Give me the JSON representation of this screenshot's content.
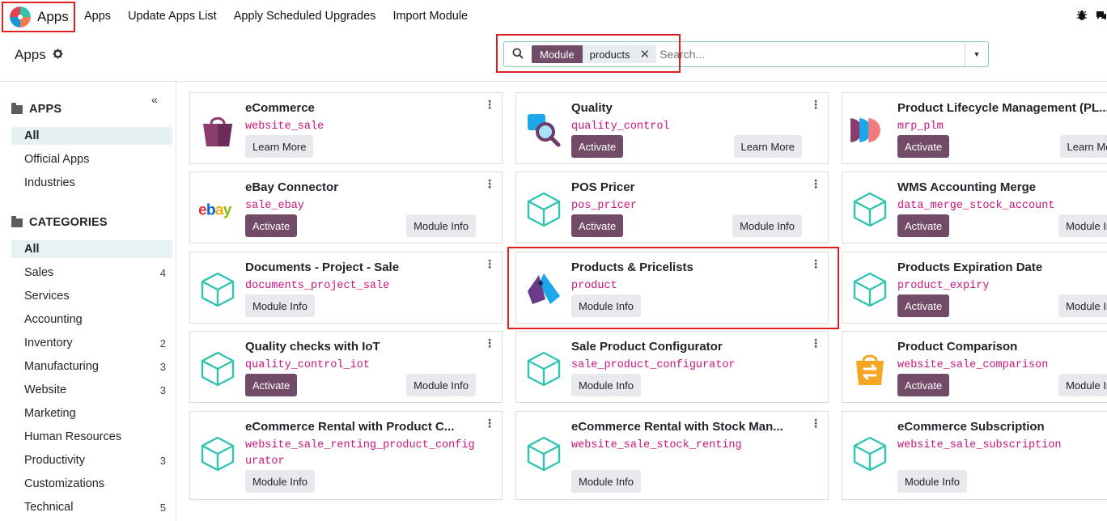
{
  "navbar": {
    "brand": "Apps",
    "menu": [
      "Apps",
      "Update Apps List",
      "Apply Scheduled Upgrades",
      "Import Module"
    ],
    "icons": [
      "bug-icon",
      "chat-icon"
    ]
  },
  "control_panel": {
    "breadcrumb": "Apps",
    "search": {
      "facet_field": "Module",
      "facet_value": "products",
      "placeholder": "Search..."
    }
  },
  "sidebar": {
    "apps_title": "APPS",
    "apps": [
      "All",
      "Official Apps",
      "Industries"
    ],
    "categories_title": "CATEGORIES",
    "categories": [
      {
        "label": "All",
        "count": ""
      },
      {
        "label": "Sales",
        "count": "4"
      },
      {
        "label": "Services",
        "count": ""
      },
      {
        "label": "Accounting",
        "count": ""
      },
      {
        "label": "Inventory",
        "count": "2"
      },
      {
        "label": "Manufacturing",
        "count": "3"
      },
      {
        "label": "Website",
        "count": "3"
      },
      {
        "label": "Marketing",
        "count": ""
      },
      {
        "label": "Human Resources",
        "count": ""
      },
      {
        "label": "Productivity",
        "count": "3"
      },
      {
        "label": "Customizations",
        "count": ""
      },
      {
        "label": "Technical",
        "count": "5"
      }
    ]
  },
  "cards": [
    {
      "title": "eCommerce",
      "tech_name": "website_sale",
      "tech_name_2": "",
      "icon": "shopping-bag-icon",
      "primary": "",
      "secondary": "Learn More"
    },
    {
      "title": "Quality",
      "tech_name": "quality_control",
      "tech_name_2": "",
      "icon": "quality-icon",
      "primary": "Activate",
      "secondary": "Learn More"
    },
    {
      "title": "Product Lifecycle Management (PL...",
      "tech_name": "mrp_plm",
      "tech_name_2": "",
      "icon": "plm-icon",
      "primary": "Activate",
      "secondary": "Learn More"
    },
    {
      "title": "eBay Connector",
      "tech_name": "sale_ebay",
      "tech_name_2": "",
      "icon": "ebay-logo",
      "primary": "Activate",
      "secondary": "Module Info"
    },
    {
      "title": "POS Pricer",
      "tech_name": "pos_pricer",
      "tech_name_2": "",
      "icon": "module-cube-icon",
      "primary": "Activate",
      "secondary": "Module Info"
    },
    {
      "title": "WMS Accounting Merge",
      "tech_name": "data_merge_stock_account",
      "tech_name_2": "",
      "icon": "module-cube-icon",
      "primary": "Activate",
      "secondary": "Module Info"
    },
    {
      "title": "Documents - Project - Sale",
      "tech_name": "documents_project_sale",
      "tech_name_2": "",
      "icon": "module-cube-icon",
      "primary": "",
      "secondary": "Module Info"
    },
    {
      "title": "Products & Pricelists",
      "tech_name": "product",
      "tech_name_2": "",
      "icon": "price-tag-icon",
      "primary": "",
      "secondary": "Module Info"
    },
    {
      "title": "Products Expiration Date",
      "tech_name": "product_expiry",
      "tech_name_2": "",
      "icon": "module-cube-icon",
      "primary": "Activate",
      "secondary": "Module Info"
    },
    {
      "title": "Quality checks with IoT",
      "tech_name": "quality_control_iot",
      "tech_name_2": "",
      "icon": "module-cube-icon",
      "primary": "Activate",
      "secondary": "Module Info"
    },
    {
      "title": "Sale Product Configurator",
      "tech_name": "sale_product_configurator",
      "tech_name_2": "",
      "icon": "module-cube-icon",
      "primary": "",
      "secondary": "Module Info"
    },
    {
      "title": "Product Comparison",
      "tech_name": "website_sale_comparison",
      "tech_name_2": "",
      "icon": "shopping-bag-swap-icon",
      "primary": "Activate",
      "secondary": "Module Info"
    },
    {
      "title": "eCommerce Rental with Product C...",
      "tech_name": "website_sale_renting_product_config",
      "tech_name_2": "urator",
      "icon": "module-cube-icon",
      "primary": "",
      "secondary": "Module Info"
    },
    {
      "title": "eCommerce Rental with Stock Man...",
      "tech_name": "website_sale_stock_renting",
      "tech_name_2": "",
      "icon": "module-cube-icon",
      "primary": "",
      "secondary": "Module Info"
    },
    {
      "title": "eCommerce Subscription",
      "tech_name": "website_sale_subscription",
      "tech_name_2": "",
      "icon": "module-cube-icon",
      "primary": "",
      "secondary": "Module Info"
    }
  ],
  "colors": {
    "primary": "#714b67",
    "tech_name": "#c7157f",
    "cube": "#2ec4b0",
    "highlight": "#e02020"
  }
}
